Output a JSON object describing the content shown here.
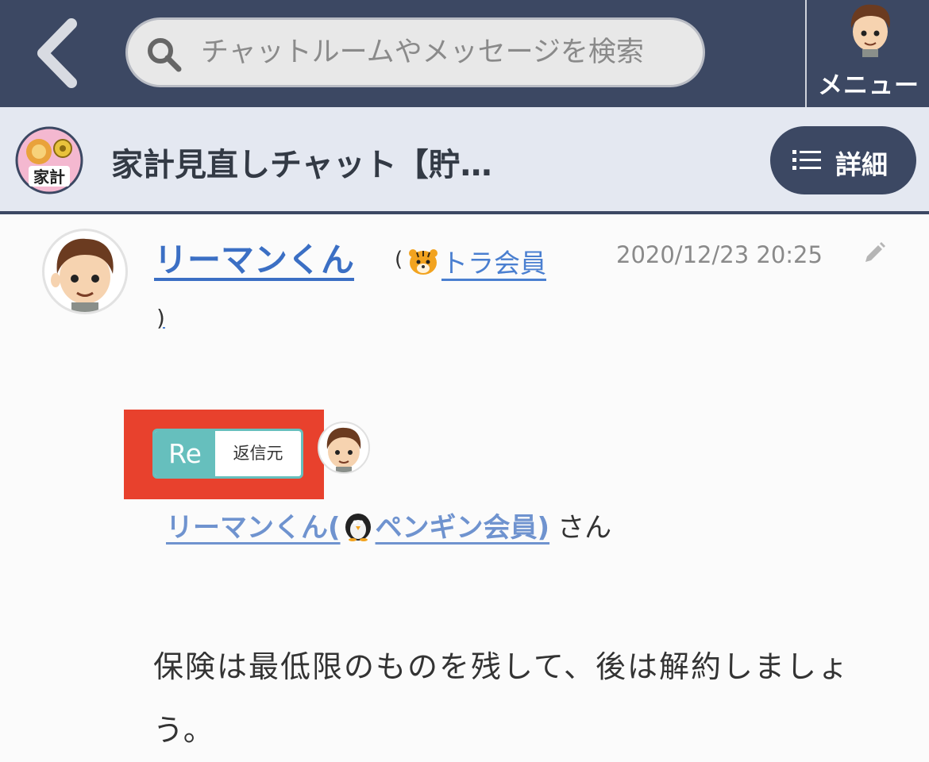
{
  "nav": {
    "search_placeholder": "チャットルームやメッセージを検索",
    "menu_label": "メニュー"
  },
  "room": {
    "title": "家計見直しチャット【貯…",
    "avatar_text": "家計",
    "detail_label": "詳細"
  },
  "message": {
    "sender": "リーマンくん",
    "paren_open": "(",
    "rank": "トラ会員",
    "paren_close": ")",
    "timestamp": "2020/12/23 20:25",
    "reply": {
      "badge_re": "Re",
      "badge_source": "返信元",
      "to_name": "リーマンくん(",
      "to_rank": "ペンギン会員)",
      "honorific": "さん"
    },
    "body": "保険は最低限のものを残して、後は解約しましょう。"
  },
  "colors": {
    "nav_bg": "#3c4863",
    "room_bar_bg": "#e4e8f1",
    "link": "#3b6fc4",
    "reply_accent": "#66bfbd",
    "highlight_frame": "#e8412d"
  },
  "icons": {
    "back": "chevron-left-icon",
    "search": "search-icon",
    "menu": "avatar",
    "detail": "list-icon",
    "edit": "pencil-icon",
    "rank": "tiger-icon",
    "reply_rank": "penguin-icon"
  }
}
